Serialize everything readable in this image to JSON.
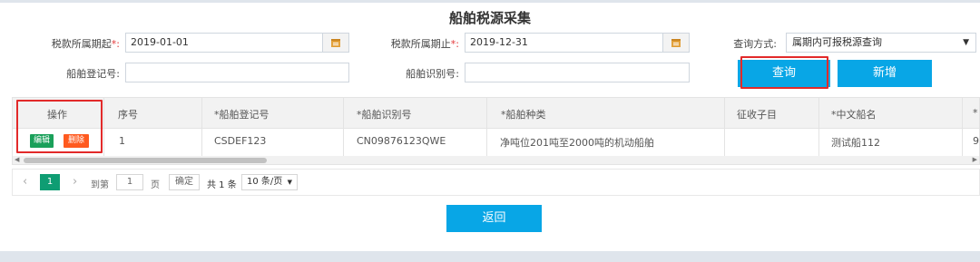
{
  "page": {
    "title": "船舶税源采集"
  },
  "form": {
    "start_label": "税款所属期起",
    "start_value": "2019-01-01",
    "end_label": "税款所属期止",
    "end_value": "2019-12-31",
    "required_mark": "*:",
    "query_method_label": "查询方式:",
    "query_method_value": "属期内可报税源查询",
    "reg_no_label": "船舶登记号:",
    "reg_no_value": "",
    "id_no_label": "船舶识别号:",
    "id_no_value": ""
  },
  "buttons": {
    "query": "查询",
    "add": "新增",
    "back": "返回"
  },
  "table": {
    "headers": [
      "操作",
      "序号",
      "*船舶登记号",
      "*船舶识别号",
      "*船舶种类",
      "征收子目",
      "*中文船名",
      "*"
    ],
    "row": {
      "edit": "编辑",
      "delete": "删除",
      "index": "1",
      "reg_no": "CSDEF123",
      "id_no": "CN09876123QWE",
      "type": "净吨位201吨至2000吨的机动船舶",
      "subitem": "",
      "name": "测试船112",
      "overflow": "9"
    }
  },
  "pager": {
    "current": "1",
    "goto_label": "到第",
    "page_value": "1",
    "page_unit": "页",
    "confirm": "确定",
    "total": "共 1 条",
    "per_page": "10 条/页"
  },
  "colors": {
    "accent": "#08a6e6",
    "edit": "#1aa05a",
    "delete": "#ff5a1f",
    "highlight": "#e22a2a"
  }
}
